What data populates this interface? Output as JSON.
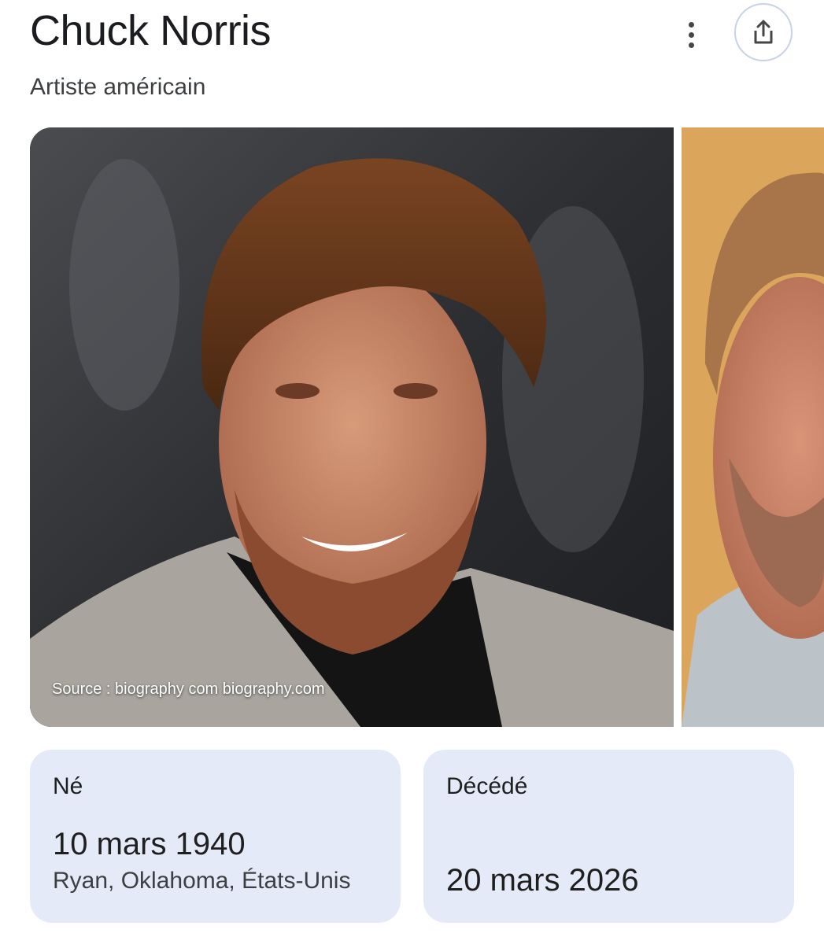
{
  "header": {
    "title": "Chuck Norris",
    "subtitle": "Artiste américain",
    "menu_icon": "more-vert-icon",
    "share_icon": "share-icon"
  },
  "images": {
    "main_source": "Source : biography com biography.com"
  },
  "facts": {
    "born": {
      "label": "Né",
      "date": "10 mars 1940",
      "place": "Ryan, Oklahoma, États-Unis"
    },
    "died": {
      "label": "Décédé",
      "date": "20 mars 2026"
    }
  },
  "colors": {
    "card_bg": "#e5eaf9",
    "share_border": "#c7d2e8"
  }
}
